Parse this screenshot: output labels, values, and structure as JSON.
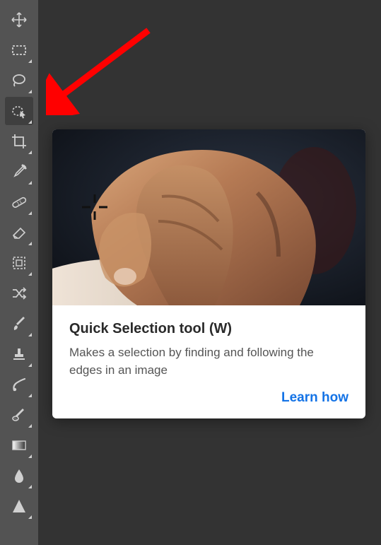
{
  "toolbar": {
    "tools": [
      {
        "name": "move-tool",
        "active": false,
        "flyout": false
      },
      {
        "name": "rectangular-marquee-tool",
        "active": false,
        "flyout": true
      },
      {
        "name": "lasso-tool",
        "active": false,
        "flyout": true
      },
      {
        "name": "quick-selection-tool",
        "active": true,
        "flyout": true
      },
      {
        "name": "crop-tool",
        "active": false,
        "flyout": true
      },
      {
        "name": "eyedropper-tool",
        "active": false,
        "flyout": true
      },
      {
        "name": "spot-healing-brush-tool",
        "active": false,
        "flyout": true
      },
      {
        "name": "eraser-tool",
        "active": false,
        "flyout": true
      },
      {
        "name": "cookie-cutter-tool",
        "active": false,
        "flyout": true
      },
      {
        "name": "random-tool",
        "active": false,
        "flyout": false
      },
      {
        "name": "brush-tool",
        "active": false,
        "flyout": true
      },
      {
        "name": "clone-stamp-tool",
        "active": false,
        "flyout": true
      },
      {
        "name": "smudge-tool",
        "active": false,
        "flyout": true
      },
      {
        "name": "sponge-tool",
        "active": false,
        "flyout": true
      },
      {
        "name": "gradient-tool",
        "active": false,
        "flyout": true
      },
      {
        "name": "blur-tool",
        "active": false,
        "flyout": true
      },
      {
        "name": "shape-tool",
        "active": false,
        "flyout": true
      }
    ]
  },
  "tooltip": {
    "title": "Quick Selection tool (W)",
    "description": "Makes a selection by finding and following the edges in an image",
    "link_label": "Learn how"
  }
}
